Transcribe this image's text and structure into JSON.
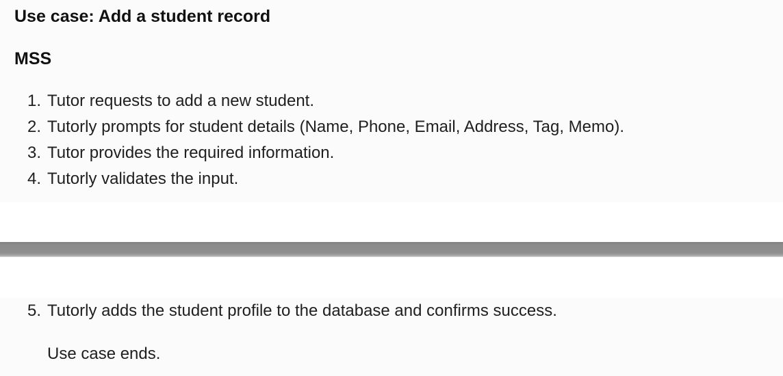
{
  "document": {
    "title": "Use case: Add a student record",
    "mss_heading": "MSS",
    "steps": [
      {
        "number": "1.",
        "text": "Tutor requests to add a new student."
      },
      {
        "number": "2.",
        "text": "Tutorly prompts for student details (Name, Phone, Email, Address, Tag, Memo)."
      },
      {
        "number": "3.",
        "text": "Tutor provides the required information."
      },
      {
        "number": "4.",
        "text": "Tutorly validates the input."
      },
      {
        "number": "5.",
        "text": "Tutorly adds the student profile to the database and confirms success."
      }
    ],
    "ending": "Use case ends."
  }
}
